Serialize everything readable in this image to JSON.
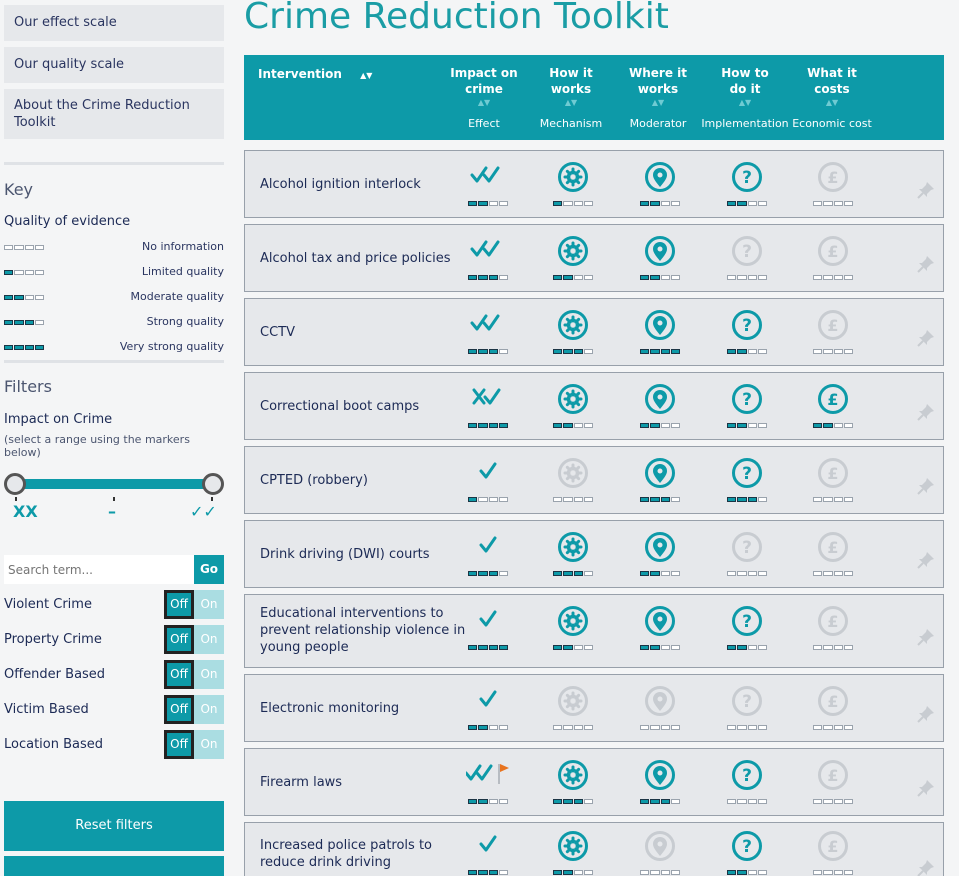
{
  "sidebar": {
    "nav": [
      "Our effect scale",
      "Our quality scale",
      "About the Crime Reduction Toolkit"
    ],
    "key_title": "Key",
    "key_subtitle": "Quality of evidence",
    "key_items": [
      {
        "label": "No information",
        "level": 0
      },
      {
        "label": "Limited quality",
        "level": 1
      },
      {
        "label": "Moderate quality",
        "level": 2
      },
      {
        "label": "Strong quality",
        "level": 3
      },
      {
        "label": "Very strong quality",
        "level": 4
      }
    ],
    "filters_title": "Filters",
    "impact_label": "Impact on Crime",
    "impact_hint": "(select a range using the markers below)",
    "slider_markers": [
      "XX",
      "–",
      "✓✓"
    ],
    "search_placeholder": "Search term...",
    "go_label": "Go",
    "toggles": [
      {
        "label": "Violent Crime",
        "off": "Off",
        "on": "On"
      },
      {
        "label": "Property Crime",
        "off": "Off",
        "on": "On"
      },
      {
        "label": "Offender Based",
        "off": "Off",
        "on": "On"
      },
      {
        "label": "Victim Based",
        "off": "Off",
        "on": "On"
      },
      {
        "label": "Location Based",
        "off": "Off",
        "on": "On"
      }
    ],
    "reset_label": "Reset filters",
    "second_button_label": ""
  },
  "title": "Crime Reduction Toolkit",
  "header": {
    "intervention": "Intervention",
    "columns": [
      {
        "line1": "Impact on",
        "line2": "crime",
        "sub": "Effect"
      },
      {
        "line1": "How it",
        "line2": "works",
        "sub": "Mechanism"
      },
      {
        "line1": "Where it",
        "line2": "works",
        "sub": "Moderator"
      },
      {
        "line1": "How to",
        "line2": "do it",
        "sub": "Implementation"
      },
      {
        "line1": "What it",
        "line2": "costs",
        "sub": "Economic cost"
      }
    ]
  },
  "colors": {
    "teal": "#0d9aa8",
    "faded": "#c8ccd1",
    "flag": "#e8731e"
  },
  "icons": {
    "mechanism": "gear-icon",
    "moderator": "location-pin-icon",
    "implementation": "question-icon",
    "cost": "pound-icon",
    "pin": "pushpin-icon"
  },
  "rows": [
    {
      "name": "Alcohol ignition interlock",
      "effect": "vv",
      "q": [
        2,
        1,
        2,
        2,
        0
      ],
      "on": [
        1,
        1,
        1,
        0
      ]
    },
    {
      "name": "Alcohol tax and price policies",
      "effect": "vv",
      "q": [
        3,
        2,
        2,
        0,
        0
      ],
      "on": [
        1,
        1,
        0,
        0
      ]
    },
    {
      "name": "CCTV",
      "effect": "vv",
      "q": [
        3,
        3,
        4,
        2,
        0
      ],
      "on": [
        1,
        1,
        1,
        0
      ]
    },
    {
      "name": "Correctional boot camps",
      "effect": "xv",
      "q": [
        4,
        2,
        2,
        2,
        2
      ],
      "on": [
        1,
        1,
        1,
        1
      ]
    },
    {
      "name": "CPTED (robbery)",
      "effect": "v",
      "q": [
        1,
        0,
        3,
        3,
        0
      ],
      "on": [
        0,
        1,
        1,
        0
      ]
    },
    {
      "name": "Drink driving (DWI) courts",
      "effect": "v",
      "q": [
        3,
        3,
        2,
        0,
        0
      ],
      "on": [
        1,
        1,
        0,
        0
      ]
    },
    {
      "name": "Educational interventions to prevent relationship violence in young people",
      "effect": "v",
      "q": [
        4,
        2,
        2,
        2,
        0
      ],
      "on": [
        1,
        1,
        1,
        0
      ]
    },
    {
      "name": "Electronic monitoring",
      "effect": "v",
      "q": [
        2,
        0,
        0,
        0,
        0
      ],
      "on": [
        0,
        0,
        0,
        0
      ]
    },
    {
      "name": "Firearm laws",
      "effect": "vvf",
      "q": [
        2,
        3,
        3,
        0,
        0
      ],
      "on": [
        1,
        1,
        1,
        0
      ]
    },
    {
      "name": "Increased police patrols to reduce drink driving",
      "effect": "v",
      "q": [
        3,
        2,
        0,
        2,
        0
      ],
      "on": [
        1,
        0,
        1,
        0
      ]
    }
  ]
}
